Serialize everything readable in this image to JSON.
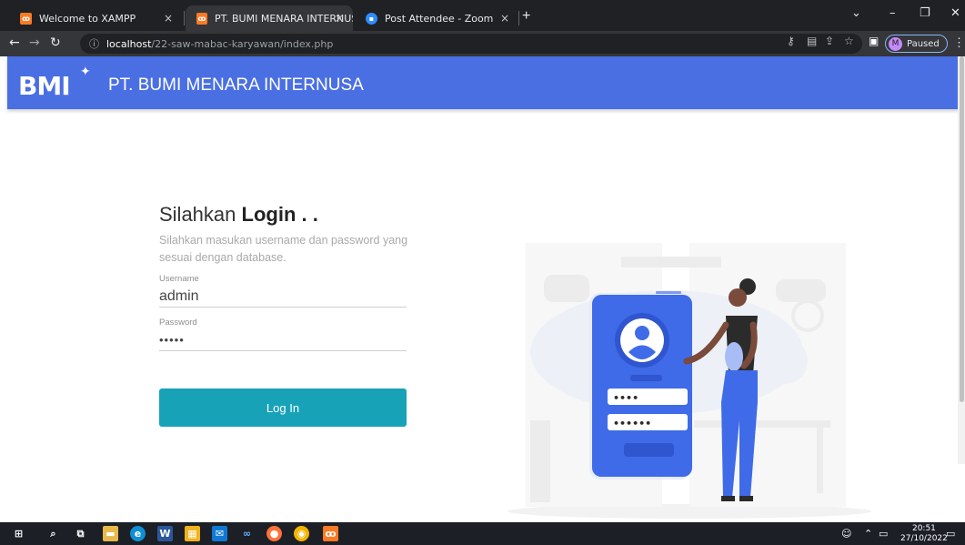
{
  "browser": {
    "tabs": [
      {
        "title": "Welcome to XAMPP",
        "active": false,
        "favicon": "xampp-icon"
      },
      {
        "title": "PT. BUMI MENARA INTERNUSA",
        "active": true,
        "favicon": "xampp-icon"
      },
      {
        "title": "Post Attendee - Zoom",
        "active": false,
        "favicon": "zoom-icon"
      }
    ],
    "new_tab": "+",
    "close_glyph": "×",
    "url_host": "localhost",
    "url_path": "/22-saw-mabac-karyawan/index.php",
    "profile_initial": "M",
    "profile_status": "Paused"
  },
  "header": {
    "logo_text": "BMI",
    "company_name": "PT. BUMI MENARA INTERNUSA"
  },
  "login": {
    "title_prefix": "Silahkan ",
    "title_bold": "Login . .",
    "description": "Silahkan masukan username dan password yang sesuai dengan database.",
    "username_label": "Username",
    "username_value": "admin",
    "password_label": "Password",
    "password_value": "•••••",
    "button_label": "Log In"
  },
  "illustration": {
    "password_dots_1": "••••",
    "password_dots_2": "••••••"
  },
  "taskbar": {
    "time": "20:51",
    "date": "27/10/2022"
  },
  "colors": {
    "header": "#4a6fe3",
    "button": "#17a2b8",
    "phone": "#3f6be8"
  }
}
